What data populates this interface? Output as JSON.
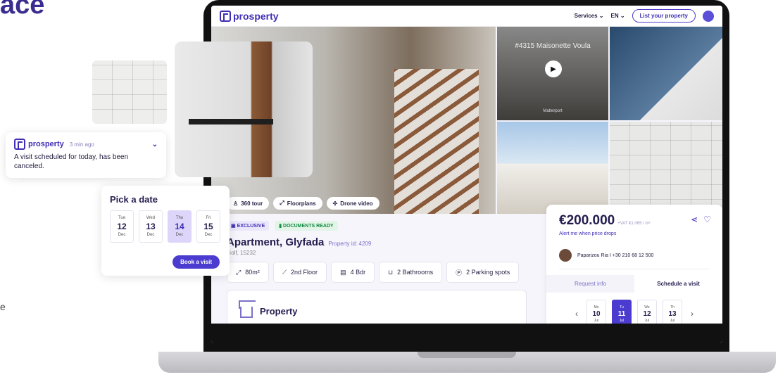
{
  "hero_fragment": "ace",
  "side_text": "e",
  "nav": {
    "logo": "prosperty",
    "services": "Services",
    "lang": "EN",
    "list_property": "List your property"
  },
  "gallery": {
    "tour_title": "#4315 Maisonette Voula",
    "matterport": "Matterport",
    "chips": [
      "360 tour",
      "Floorplans",
      "Drone video"
    ]
  },
  "listing": {
    "badge_exclusive": "EXCLUSIVE",
    "badge_documents": "DOCUMENTS READY",
    "title": "Apartment, Glyfada",
    "property_id": "Property id: 4209",
    "location": "Golf, 15232",
    "features": [
      "80m²",
      "2nd Floor",
      "4 Bdr",
      "2 Bathrooms",
      "2 Parking spots"
    ],
    "section_title": "Property"
  },
  "price_panel": {
    "price": "€200.000",
    "price_note": "+VAT €1.065 / m²",
    "alert": "Alert me when price drops",
    "agent": "Paparizou Ria  I  +30 210 68 12 500",
    "tabs": [
      "Request info",
      "Schedule a visit"
    ],
    "active_tab": "Schedule a visit",
    "days": [
      {
        "dow": "Mo",
        "num": "10",
        "mon": "Jul",
        "active": false
      },
      {
        "dow": "Tu",
        "num": "11",
        "mon": "Jul",
        "active": true
      },
      {
        "dow": "We",
        "num": "12",
        "mon": "Jul",
        "active": false
      },
      {
        "dow": "Th",
        "num": "13",
        "mon": "Jul",
        "active": false
      }
    ]
  },
  "notification": {
    "brand": "prosperty",
    "time": "3 min ago",
    "text": "A visit scheduled for today, has been canceled."
  },
  "date_picker": {
    "title": "Pick a date",
    "days": [
      {
        "dow": "Tue",
        "num": "12",
        "mon": "Dec",
        "active": false
      },
      {
        "dow": "Wed",
        "num": "13",
        "mon": "Dec",
        "active": false
      },
      {
        "dow": "Thu",
        "num": "14",
        "mon": "Dec",
        "active": true
      },
      {
        "dow": "Fri",
        "num": "15",
        "mon": "Dec",
        "active": false
      }
    ],
    "book_button": "Book a visit"
  },
  "colors": {
    "brand": "#3f2fb5",
    "accent": "#4b3ccf",
    "selected_day": "#ddd6fa"
  }
}
